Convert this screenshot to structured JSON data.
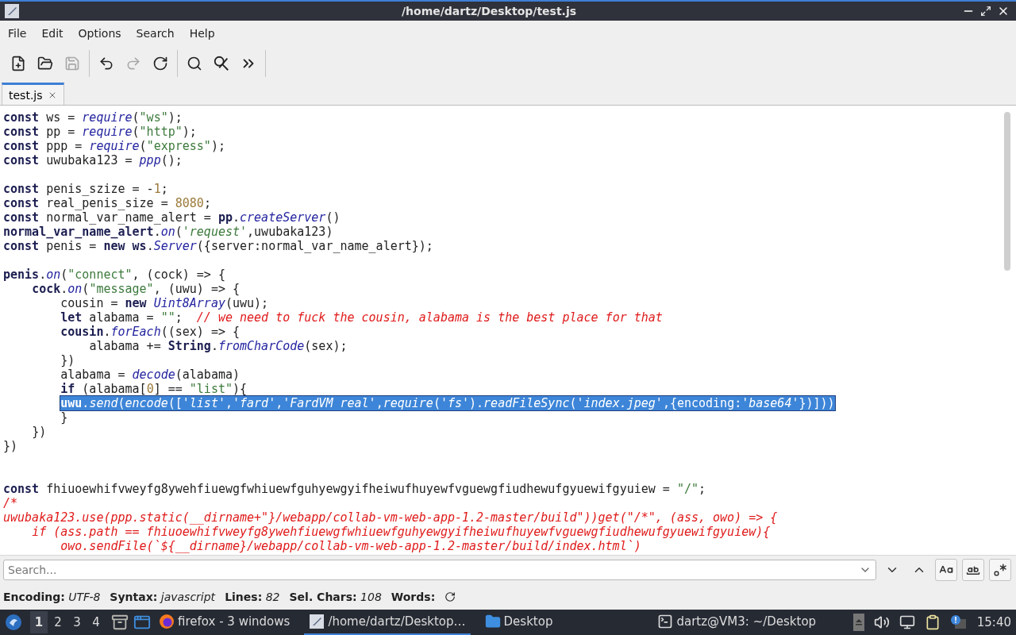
{
  "window": {
    "title": "/home/dartz/Desktop/test.js"
  },
  "menu": [
    "File",
    "Edit",
    "Options",
    "Search",
    "Help"
  ],
  "toolbar": [
    {
      "kind": "new",
      "disabled": false,
      "separator_after": false
    },
    {
      "kind": "open",
      "disabled": false,
      "separator_after": false
    },
    {
      "kind": "save",
      "disabled": true,
      "separator_after": true
    },
    {
      "kind": "undo",
      "disabled": false,
      "separator_after": false
    },
    {
      "kind": "redo",
      "disabled": true,
      "separator_after": false
    },
    {
      "kind": "reload",
      "disabled": false,
      "separator_after": true
    },
    {
      "kind": "find",
      "disabled": false,
      "separator_after": false
    },
    {
      "kind": "replace",
      "disabled": false,
      "separator_after": false
    },
    {
      "kind": "more",
      "disabled": false,
      "separator_after": true
    }
  ],
  "tabs": [
    {
      "label": "test.js",
      "selected": true
    }
  ],
  "code": [
    {
      "selected": false,
      "tokens": [
        {
          "kind": "keyword",
          "text": "const"
        },
        {
          "kind": "plain",
          "text": " ws = "
        },
        {
          "kind": "function",
          "text": "require"
        },
        {
          "kind": "plain",
          "text": "("
        },
        {
          "kind": "string",
          "text": "\"ws\""
        },
        {
          "kind": "plain",
          "text": ");"
        }
      ]
    },
    {
      "selected": false,
      "tokens": [
        {
          "kind": "keyword",
          "text": "const"
        },
        {
          "kind": "plain",
          "text": " pp = "
        },
        {
          "kind": "function",
          "text": "require"
        },
        {
          "kind": "plain",
          "text": "("
        },
        {
          "kind": "string",
          "text": "\"http\""
        },
        {
          "kind": "plain",
          "text": ");"
        }
      ]
    },
    {
      "selected": false,
      "tokens": [
        {
          "kind": "keyword",
          "text": "const"
        },
        {
          "kind": "plain",
          "text": " ppp = "
        },
        {
          "kind": "function",
          "text": "require"
        },
        {
          "kind": "plain",
          "text": "("
        },
        {
          "kind": "string",
          "text": "\"express\""
        },
        {
          "kind": "plain",
          "text": ");"
        }
      ]
    },
    {
      "selected": false,
      "tokens": [
        {
          "kind": "keyword",
          "text": "const"
        },
        {
          "kind": "plain",
          "text": " uwubaka123 = "
        },
        {
          "kind": "function",
          "text": "ppp"
        },
        {
          "kind": "plain",
          "text": "();"
        }
      ]
    },
    {
      "selected": false
    },
    {
      "selected": false,
      "tokens": [
        {
          "kind": "keyword",
          "text": "const"
        },
        {
          "kind": "plain",
          "text": " penis_szize = -"
        },
        {
          "kind": "number",
          "text": "1"
        },
        {
          "kind": "plain",
          "text": ";"
        }
      ]
    },
    {
      "selected": false,
      "tokens": [
        {
          "kind": "keyword",
          "text": "const"
        },
        {
          "kind": "plain",
          "text": " real_penis_size = "
        },
        {
          "kind": "number",
          "text": "8080"
        },
        {
          "kind": "plain",
          "text": ";"
        }
      ]
    },
    {
      "selected": false,
      "tokens": [
        {
          "kind": "keyword",
          "text": "const"
        },
        {
          "kind": "plain",
          "text": " normal_var_name_alert = "
        },
        {
          "kind": "keyword",
          "text": "pp"
        },
        {
          "kind": "plain",
          "text": "."
        },
        {
          "kind": "function",
          "text": "createServer"
        },
        {
          "kind": "plain",
          "text": "()"
        }
      ]
    },
    {
      "selected": false,
      "tokens": [
        {
          "kind": "keyword",
          "text": "normal_var_name_alert"
        },
        {
          "kind": "plain",
          "text": "."
        },
        {
          "kind": "function",
          "text": "on"
        },
        {
          "kind": "plain",
          "text": "("
        },
        {
          "kind": "char",
          "text": "'request'"
        },
        {
          "kind": "plain",
          "text": ",uwubaka123)"
        }
      ]
    },
    {
      "selected": false,
      "tokens": [
        {
          "kind": "keyword",
          "text": "const"
        },
        {
          "kind": "plain",
          "text": " penis = "
        },
        {
          "kind": "keyword",
          "text": "new ws"
        },
        {
          "kind": "plain",
          "text": "."
        },
        {
          "kind": "function",
          "text": "Server"
        },
        {
          "kind": "plain",
          "text": "({server:normal_var_name_alert});"
        }
      ]
    },
    {
      "selected": false
    },
    {
      "selected": false,
      "tokens": [
        {
          "kind": "keyword",
          "text": "penis"
        },
        {
          "kind": "plain",
          "text": "."
        },
        {
          "kind": "function",
          "text": "on"
        },
        {
          "kind": "plain",
          "text": "("
        },
        {
          "kind": "string",
          "text": "\"connect\""
        },
        {
          "kind": "plain",
          "text": ", (cock) => {"
        }
      ]
    },
    {
      "selected": false,
      "tokens": [
        {
          "kind": "keyword",
          "text": "    cock"
        },
        {
          "kind": "plain",
          "text": "."
        },
        {
          "kind": "function",
          "text": "on"
        },
        {
          "kind": "plain",
          "text": "("
        },
        {
          "kind": "string",
          "text": "\"message\""
        },
        {
          "kind": "plain",
          "text": ", (uwu) => {"
        }
      ]
    },
    {
      "selected": false,
      "tokens": [
        {
          "kind": "plain",
          "text": "        cousin = "
        },
        {
          "kind": "keyword",
          "text": "new"
        },
        {
          "kind": "function",
          "text": " Uint8Array"
        },
        {
          "kind": "plain",
          "text": "(uwu);"
        }
      ]
    },
    {
      "selected": false,
      "tokens": [
        {
          "kind": "keyword",
          "text": "        let"
        },
        {
          "kind": "plain",
          "text": " alabama = "
        },
        {
          "kind": "string",
          "text": "\"\""
        },
        {
          "kind": "plain",
          "text": ";"
        },
        {
          "kind": "comment",
          "text": "  // we need to fuck the cousin, alabama is the best place for that"
        }
      ]
    },
    {
      "selected": false,
      "tokens": [
        {
          "kind": "keyword",
          "text": "        cousin"
        },
        {
          "kind": "plain",
          "text": "."
        },
        {
          "kind": "function",
          "text": "forEach"
        },
        {
          "kind": "plain",
          "text": "((sex) => {"
        }
      ]
    },
    {
      "selected": false,
      "tokens": [
        {
          "kind": "plain",
          "text": "            alabama += "
        },
        {
          "kind": "keyword",
          "text": "String"
        },
        {
          "kind": "plain",
          "text": "."
        },
        {
          "kind": "function",
          "text": "fromCharCode"
        },
        {
          "kind": "plain",
          "text": "(sex);"
        }
      ]
    },
    {
      "selected": false,
      "tokens": [
        {
          "kind": "plain",
          "text": "        })"
        }
      ]
    },
    {
      "selected": false,
      "tokens": [
        {
          "kind": "plain",
          "text": "        alabama = "
        },
        {
          "kind": "function",
          "text": "decode"
        },
        {
          "kind": "plain",
          "text": "(alabama)"
        }
      ]
    },
    {
      "selected": false,
      "tokens": [
        {
          "kind": "keyword",
          "text": "        if"
        },
        {
          "kind": "plain",
          "text": " (alabama["
        },
        {
          "kind": "number",
          "text": "0"
        },
        {
          "kind": "plain",
          "text": "] == "
        },
        {
          "kind": "string",
          "text": "\"list\""
        },
        {
          "kind": "plain",
          "text": "){"
        }
      ]
    },
    {
      "selected": true,
      "tokens": [
        {
          "kind": "keyword",
          "text": "        uwu"
        },
        {
          "kind": "plain",
          "text": "."
        },
        {
          "kind": "function",
          "text": "send"
        },
        {
          "kind": "plain",
          "text": "("
        },
        {
          "kind": "function",
          "text": "encode"
        },
        {
          "kind": "plain",
          "text": "(["
        },
        {
          "kind": "char",
          "text": "'list'"
        },
        {
          "kind": "plain",
          "text": ","
        },
        {
          "kind": "char",
          "text": "'fard'"
        },
        {
          "kind": "plain",
          "text": ","
        },
        {
          "kind": "char",
          "text": "'FardVM real'"
        },
        {
          "kind": "plain",
          "text": ","
        },
        {
          "kind": "function",
          "text": "require"
        },
        {
          "kind": "plain",
          "text": "("
        },
        {
          "kind": "char",
          "text": "'fs'"
        },
        {
          "kind": "plain",
          "text": ")."
        },
        {
          "kind": "function",
          "text": "readFileSync"
        },
        {
          "kind": "plain",
          "text": "("
        },
        {
          "kind": "char",
          "text": "'index.jpeg'"
        },
        {
          "kind": "plain",
          "text": ",{encoding:"
        },
        {
          "kind": "char",
          "text": "'base64'"
        },
        {
          "kind": "plain",
          "text": "})]))"
        }
      ]
    },
    {
      "selected": false,
      "tokens": [
        {
          "kind": "plain",
          "text": "        }"
        }
      ]
    },
    {
      "selected": false,
      "tokens": [
        {
          "kind": "plain",
          "text": "    })"
        }
      ]
    },
    {
      "selected": false,
      "tokens": [
        {
          "kind": "plain",
          "text": "})"
        }
      ]
    },
    {
      "selected": false
    },
    {
      "selected": false
    },
    {
      "selected": false,
      "tokens": [
        {
          "kind": "keyword",
          "text": "const"
        },
        {
          "kind": "plain",
          "text": " fhiuoewhifvweyfg8ywehfiuewgfwhiuewfguhyewgyifheiwufhuyewfvguewgfiudhewufgyuewifgyuiew = "
        },
        {
          "kind": "string",
          "text": "\"/\""
        },
        {
          "kind": "plain",
          "text": ";"
        }
      ]
    },
    {
      "selected": false,
      "tokens": [
        {
          "kind": "comment",
          "text": "/*"
        }
      ]
    },
    {
      "selected": false,
      "tokens": [
        {
          "kind": "comment",
          "text": "uwubaka123.use(ppp.static(__dirname+\"}/webapp/collab-vm-web-app-1.2-master/build\"))get(\"/*\", (ass, owo) => {"
        }
      ]
    },
    {
      "selected": false,
      "tokens": [
        {
          "kind": "comment",
          "text": "    if (ass.path == fhiuoewhifvweyfg8ywehfiuewgfwhiuewfguhyewgyifheiwufhuyewfvguewgfiudhewufgyuewifgyuiew){"
        }
      ]
    },
    {
      "selected": false,
      "tokens": [
        {
          "kind": "comment",
          "text": "        owo.sendFile(`${__dirname}/webapp/collab-vm-web-app-1.2-master/build/index.html`)"
        }
      ]
    }
  ],
  "search": {
    "placeholder": "Search..."
  },
  "search_options": [
    {
      "kind": "case"
    },
    {
      "kind": "word"
    },
    {
      "kind": "regex"
    }
  ],
  "status": [
    {
      "label": "Encoding:",
      "value": "UTF-8"
    },
    {
      "label": "Syntax:",
      "value": "javascript"
    },
    {
      "label": "Lines:",
      "value": "82"
    },
    {
      "label": "Sel. Chars:",
      "value": "108"
    },
    {
      "label": "Words:"
    }
  ],
  "taskbar": {
    "workspaces": [
      {
        "label": "1",
        "selected": true
      },
      {
        "label": "2",
        "selected": false
      },
      {
        "label": "3",
        "selected": false
      },
      {
        "label": "4",
        "selected": false
      }
    ],
    "tasks": [
      {
        "kind": "firefox",
        "label": "firefox - 3 windows",
        "selected": false
      },
      {
        "kind": "editor",
        "label": "/home/dartz/Desktop…",
        "selected": true
      },
      {
        "kind": "folder",
        "label": "Desktop",
        "selected": false
      },
      {
        "kind": "terminal",
        "label": "dartz@VM3: ~/Desktop",
        "selected": false
      }
    ],
    "clock": "15:40"
  }
}
